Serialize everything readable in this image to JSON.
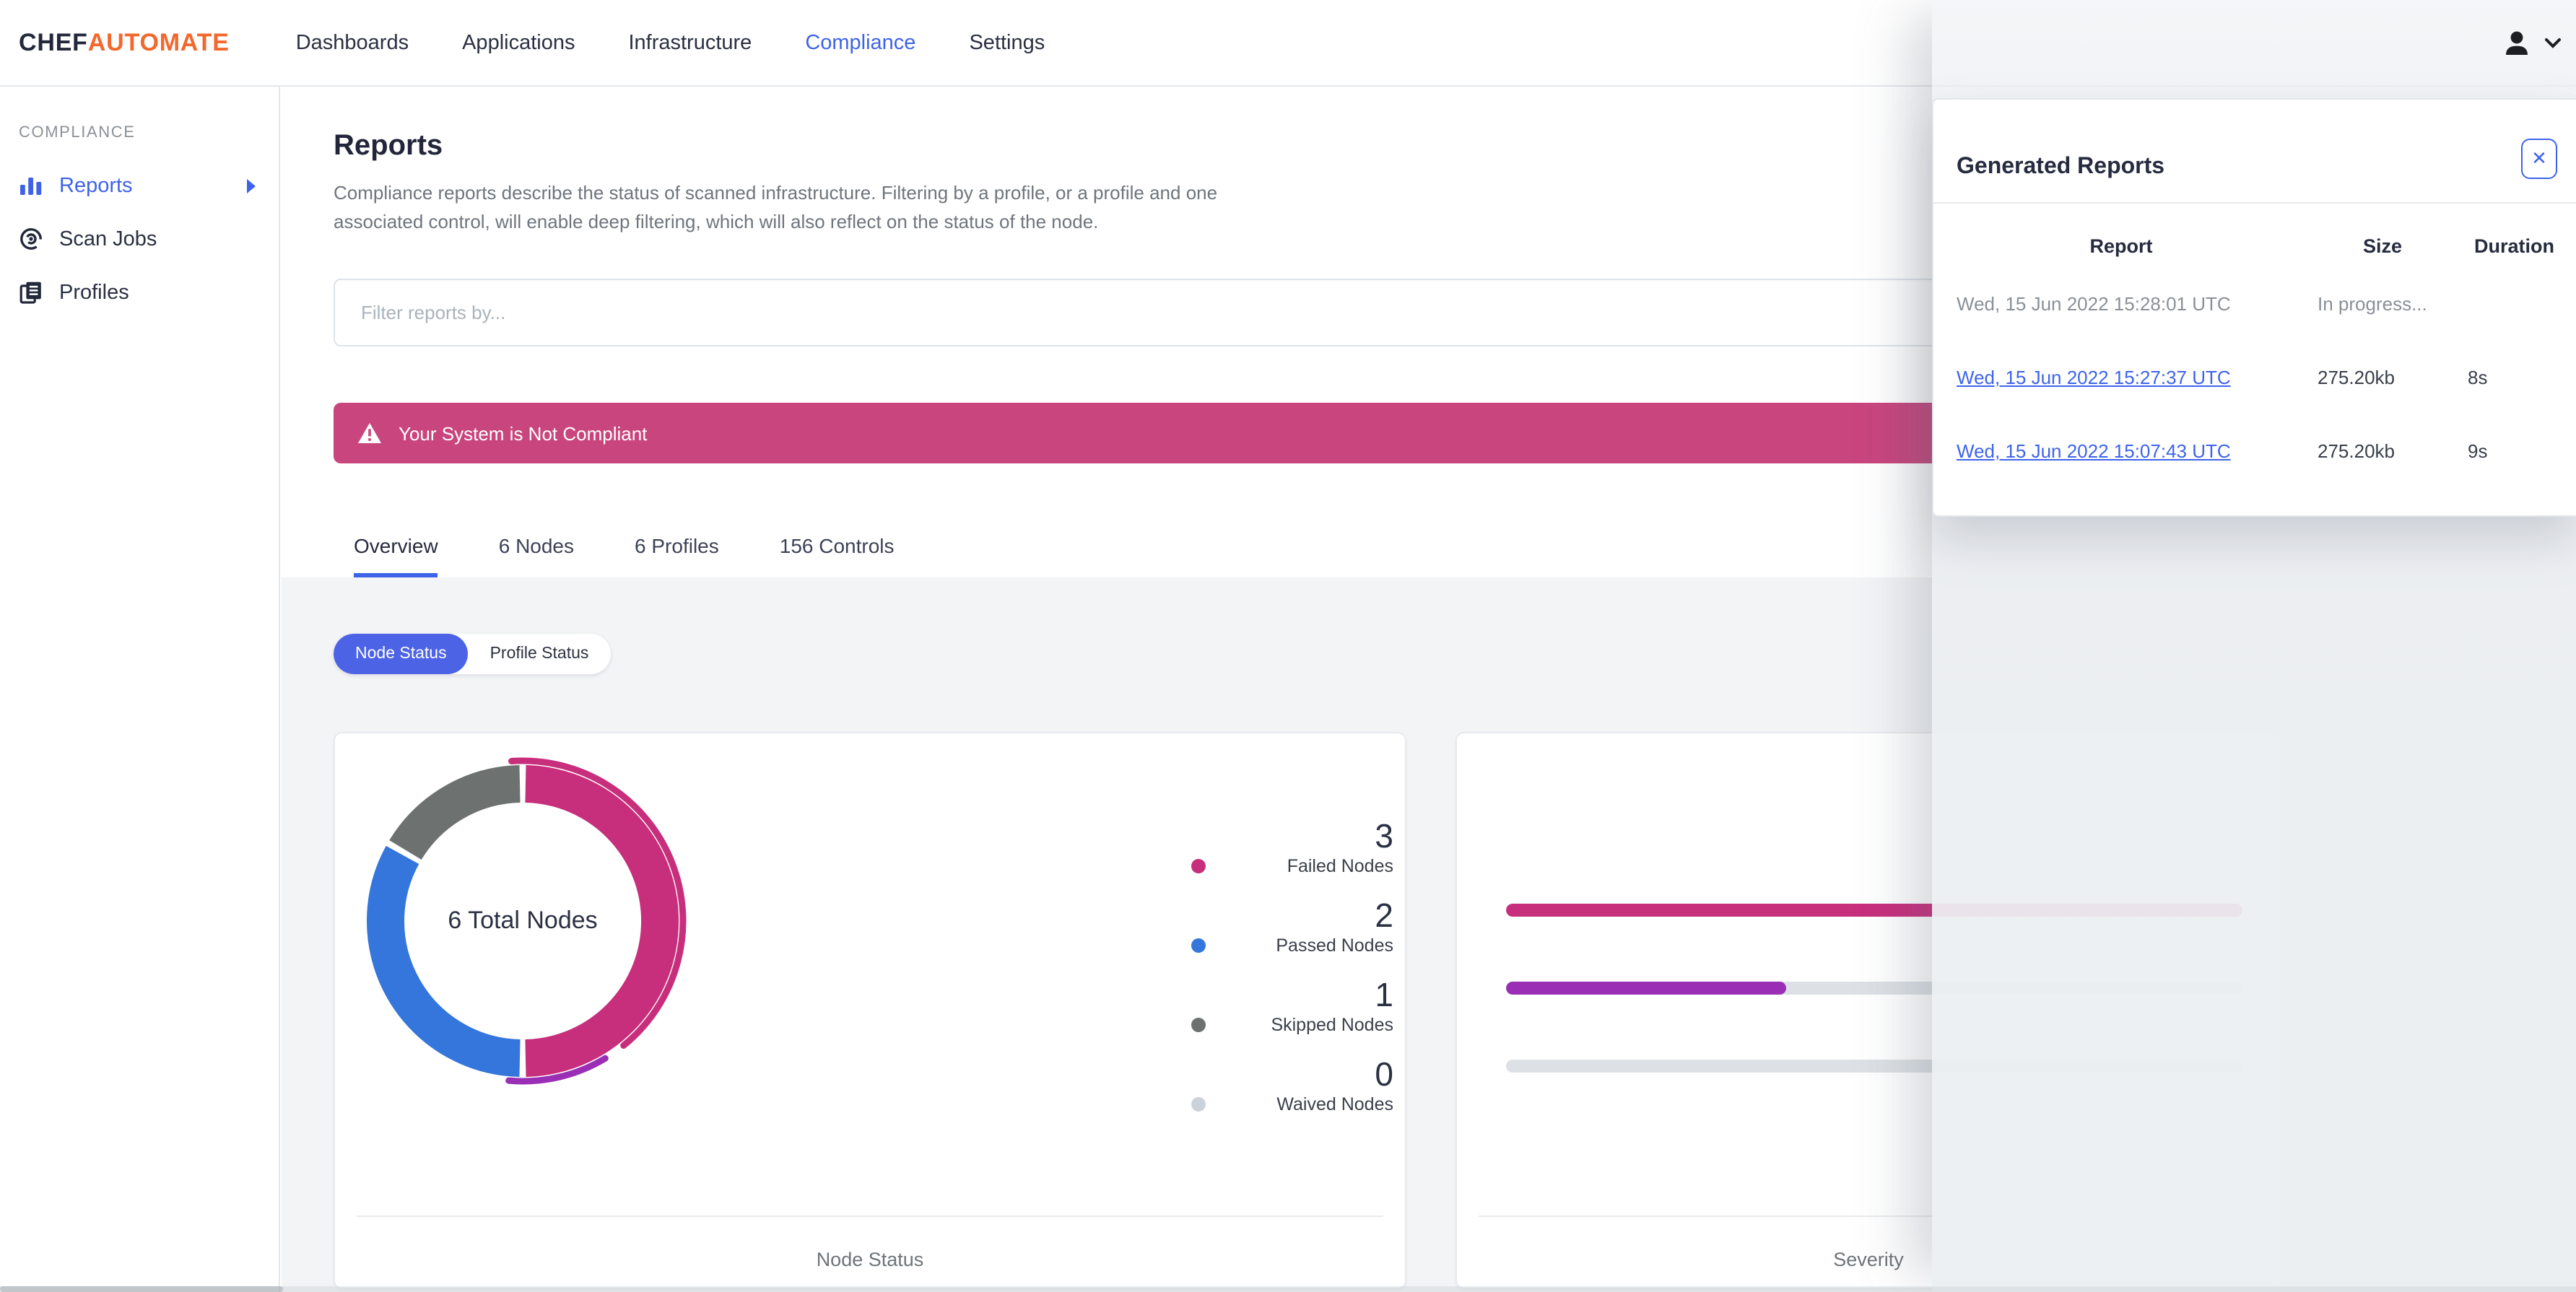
{
  "nav": {
    "logo_chef": "CHEF",
    "logo_automate": "AUTOMATE",
    "items": [
      {
        "label": "Dashboards",
        "active": false
      },
      {
        "label": "Applications",
        "active": false
      },
      {
        "label": "Infrastructure",
        "active": false
      },
      {
        "label": "Compliance",
        "active": true
      },
      {
        "label": "Settings",
        "active": false
      }
    ]
  },
  "sidebar": {
    "section": "COMPLIANCE",
    "items": [
      {
        "label": "Reports",
        "icon": "bar-chart-icon",
        "active": true
      },
      {
        "label": "Scan Jobs",
        "icon": "scan-target-icon",
        "active": false
      },
      {
        "label": "Profiles",
        "icon": "profiles-doc-icon",
        "active": false
      }
    ]
  },
  "main": {
    "title": "Reports",
    "description": "Compliance reports describe the status of scanned infrastructure. Filtering by a profile, or a profile and one associated control, will enable deep filtering, which will also reflect on the status of the node.",
    "filter_placeholder": "Filter reports by...",
    "banner": {
      "text": "Your System is Not Compliant",
      "color": "#C9457E"
    },
    "tabs": [
      {
        "label": "Overview",
        "active": true
      },
      {
        "label": "6 Nodes",
        "active": false
      },
      {
        "label": "6 Profiles",
        "active": false
      },
      {
        "label": "156 Controls",
        "active": false
      }
    ],
    "toggle": [
      {
        "label": "Node Status",
        "active": true
      },
      {
        "label": "Profile Status",
        "active": false
      }
    ]
  },
  "panel": {
    "title": "Generated Reports",
    "close_label": "✕",
    "columns": [
      "Report",
      "Size",
      "Duration"
    ],
    "rows": [
      {
        "report": "Wed, 15 Jun 2022 15:28:01 UTC",
        "size": "In progress...",
        "duration": "",
        "link": false
      },
      {
        "report": "Wed, 15 Jun 2022 15:27:37 UTC",
        "size": "275.20kb",
        "duration": "8s",
        "link": true
      },
      {
        "report": "Wed, 15 Jun 2022 15:07:43 UTC",
        "size": "275.20kb",
        "duration": "9s",
        "link": true
      }
    ]
  },
  "chart_data": [
    {
      "type": "pie",
      "title": "Node Status",
      "center_label": "6 Total Nodes",
      "total": 6,
      "series": [
        {
          "name": "Failed Nodes",
          "value": 3,
          "color": "#C72E7C"
        },
        {
          "name": "Passed Nodes",
          "value": 2,
          "color": "#3476DB"
        },
        {
          "name": "Skipped Nodes",
          "value": 1,
          "color": "#6D7271"
        },
        {
          "name": "Waived Nodes",
          "value": 0,
          "color": "#CBD2D9"
        }
      ],
      "outer_arcs": [
        {
          "start_deg": -4,
          "end_deg": 141,
          "color": "#C72E7C"
        },
        {
          "start_deg": 149,
          "end_deg": 185,
          "color": "#9A2FB5"
        }
      ],
      "legend_position": "right"
    },
    {
      "type": "bar",
      "title": "Severity",
      "orientation": "horizontal",
      "axis_labels_visible": false,
      "series": [
        {
          "name": "bar-1",
          "fraction": 1.0,
          "color": "#C72E7C"
        },
        {
          "name": "bar-2",
          "fraction": 0.38,
          "color": "#9A2FB5"
        },
        {
          "name": "bar-3",
          "fraction": 0.0,
          "color": "#DDE1E5"
        }
      ],
      "track_color": "#DDE1E5"
    }
  ],
  "colors": {
    "primary_blue": "#3F63E8",
    "toggle_blue": "#4C63E6",
    "logo_orange": "#F2682D",
    "banner_pink": "#C9457E",
    "donut_pink": "#C72E7C",
    "donut_blue": "#3476DB",
    "donut_gray": "#6D7271",
    "waived_gray": "#CBD2D9",
    "purple": "#9A2FB5",
    "page_bg": "#F2F4F6",
    "dark_text": "#262B3F",
    "muted_text": "#6F757D"
  }
}
